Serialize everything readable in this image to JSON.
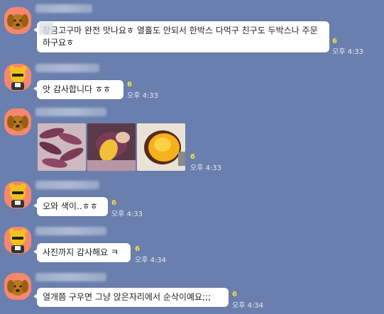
{
  "messages": [
    {
      "avatar": "dog-avatar",
      "text": "황금고구마 완전 맛나요ㅎ 열흘도 안되서 한박스 다먹구 친구도 두박스나 주문하구요ㅎ",
      "unread": "6",
      "time": "오후 4:33"
    },
    {
      "avatar": "bear-avatar",
      "text": "앗 감사합니다 ㅎㅎ",
      "unread": "6",
      "time": "오후 4:33"
    },
    {
      "avatar": "dog-avatar",
      "photos": [
        "raw-sweet-potatoes-photo",
        "cut-sweet-potato-photo",
        "roasted-sweet-potato-photo"
      ],
      "unread": "6",
      "time": "오후 4:33"
    },
    {
      "avatar": "bear-avatar",
      "text": "오와 색이..ㅎㅎ",
      "unread": "6",
      "time": "오후 4:33"
    },
    {
      "avatar": "bear-avatar",
      "text": "사진까지 감사해요 ㅋ",
      "unread": "6",
      "time": "오후 4:34"
    },
    {
      "avatar": "dog-avatar",
      "text": "열개쯤 구우면 그냥 앉은자리에서 순삭이예요;;;",
      "unread": "6",
      "time": "오후 4:34"
    }
  ],
  "colors": {
    "background": "#6a7fad",
    "bubble": "#ffffff",
    "unread": "#f6e53b",
    "avatar": "#f5876f"
  }
}
